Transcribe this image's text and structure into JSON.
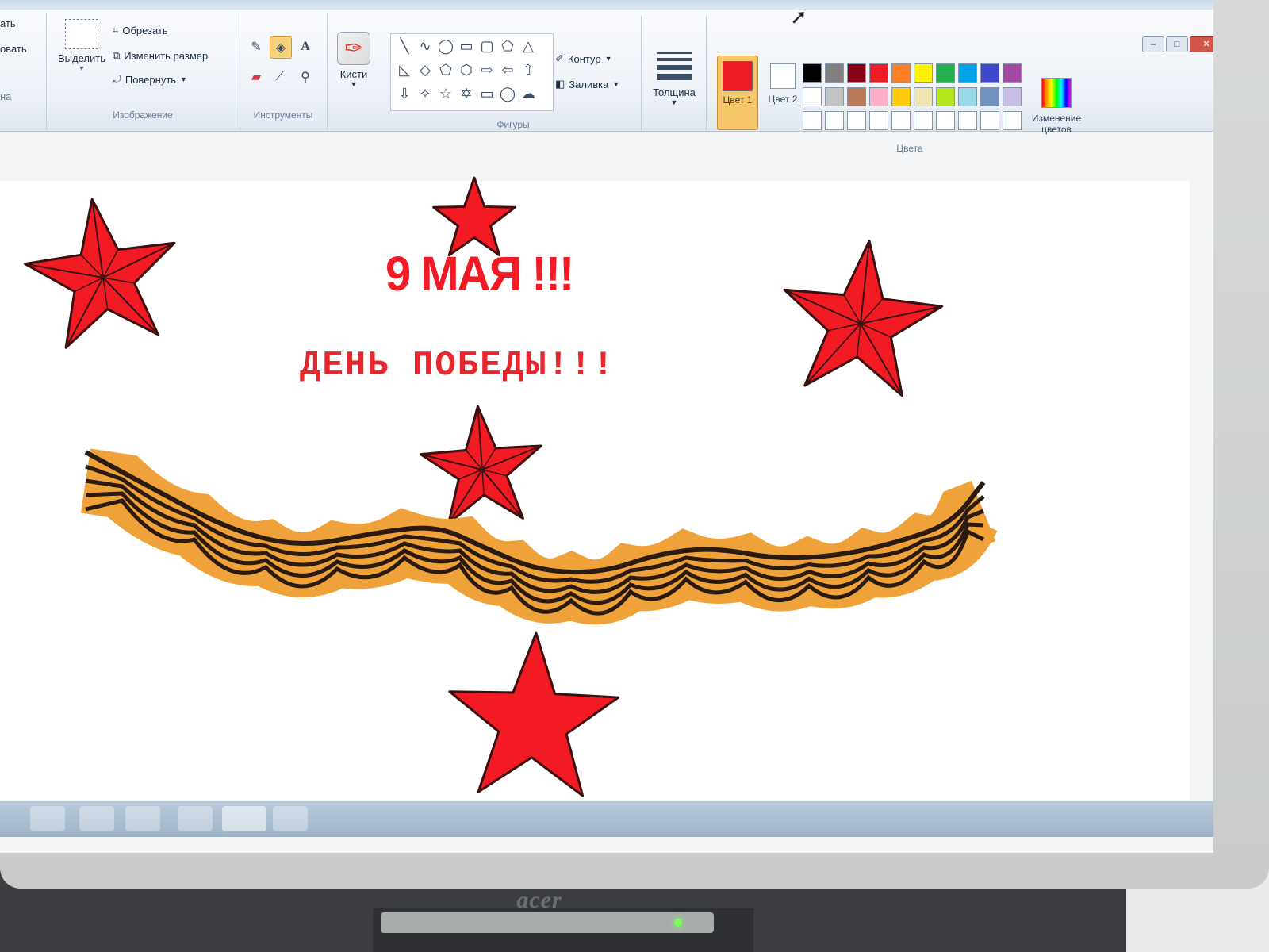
{
  "ribbon": {
    "partial_left_labels": [
      "ать",
      "овать",
      "на"
    ],
    "image_group": {
      "select_label": "Выделить",
      "crop_label": "Обрезать",
      "resize_label": "Изменить размер",
      "rotate_label": "Повернуть",
      "group_label": "Изображение"
    },
    "tools_group": {
      "group_label": "Инструменты"
    },
    "brushes_label": "Кисти",
    "shapes_group": {
      "outline_label": "Контур",
      "fill_label": "Заливка",
      "group_label": "Фигуры"
    },
    "size_label": "Толщина",
    "color1_label": "Цвет 1",
    "color2_label": "Цвет 2",
    "colors_group_label": "Цвета",
    "edit_colors_label": "Изменение цветов",
    "color1": "#ec1c24",
    "color2": "#ffffff",
    "palette_row1": [
      "#000000",
      "#7f7f7f",
      "#880015",
      "#ed1c24",
      "#ff7f27",
      "#fff200",
      "#22b14c",
      "#00a2e8",
      "#3f48cc",
      "#a349a4"
    ],
    "palette_row2": [
      "#ffffff",
      "#c3c3c3",
      "#b97a57",
      "#ffaec9",
      "#ffc90e",
      "#efe4b0",
      "#b5e61d",
      "#99d9ea",
      "#7092be",
      "#c8bfe7"
    ]
  },
  "canvas": {
    "headline": "9 МАЯ !!!",
    "subline": "ДЕНЬ ПОБЕДЫ!!!",
    "star_fill": "#f21b24",
    "star_outline": "#3a1010",
    "ribbon_orange": "#f0a23a",
    "ribbon_black": "#2a1a10"
  },
  "monitor": {
    "brand": "acer"
  }
}
